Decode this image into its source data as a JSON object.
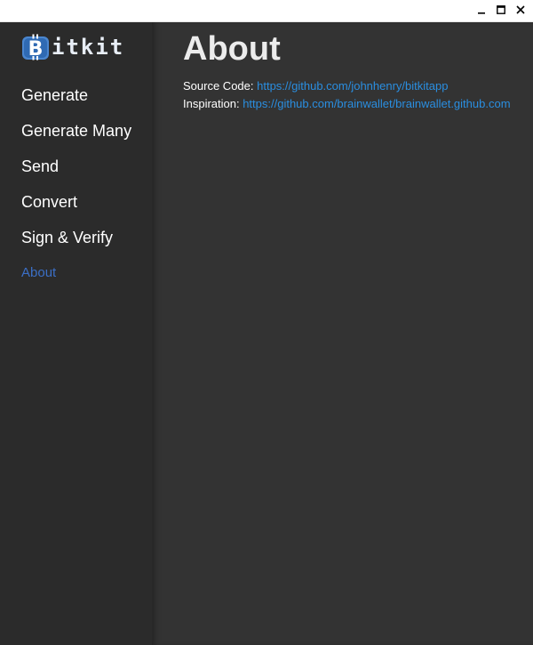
{
  "window": {
    "controls": [
      "minimize",
      "maximize",
      "close"
    ]
  },
  "sidebar": {
    "brand": {
      "icon": "bitcoin-logo",
      "text": "itkit"
    },
    "items": [
      {
        "label": "Generate"
      },
      {
        "label": "Generate Many"
      },
      {
        "label": "Send"
      },
      {
        "label": "Convert"
      },
      {
        "label": "Sign & Verify"
      },
      {
        "label": "About",
        "active": true
      }
    ]
  },
  "main": {
    "title": "About",
    "source": {
      "label": "Source Code:",
      "link": "https://github.com/johnhenry/bitkitapp"
    },
    "inspiration": {
      "label": "Inspiration:",
      "link": "https://github.com/brainwallet/brainwallet.github.com"
    }
  },
  "colors": {
    "sidebar_bg": "#2b2b2b",
    "content_bg": "#333333",
    "active_nav": "#3b6fc6",
    "link": "#2a8ee0"
  }
}
